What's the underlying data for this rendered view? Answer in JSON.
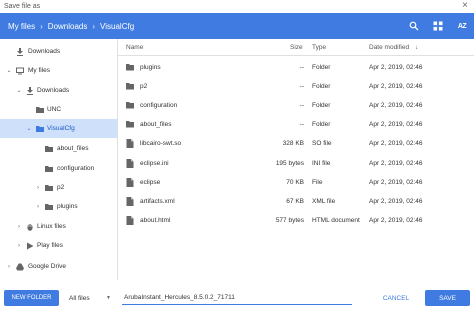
{
  "window": {
    "title": "Save file as",
    "close_glyph": "×"
  },
  "breadcrumb": {
    "items": [
      "My files",
      "Downloads",
      "VisualCfg"
    ],
    "separator": "›"
  },
  "toolbar": {
    "sort_label": "AZ",
    "icons": [
      "search-icon",
      "grid-view-icon",
      "sort-icon"
    ]
  },
  "sidebar": {
    "items": [
      {
        "label": "Downloads",
        "icon": "download-icon"
      },
      {
        "label": "My files",
        "icon": "computer-icon"
      },
      {
        "label": "Downloads",
        "icon": "download-icon"
      },
      {
        "label": "UNC",
        "icon": "folder-icon"
      },
      {
        "label": "VisualCfg",
        "icon": "folder-icon"
      },
      {
        "label": "about_files",
        "icon": "folder-icon"
      },
      {
        "label": "configuration",
        "icon": "folder-icon"
      },
      {
        "label": "p2",
        "icon": "folder-icon"
      },
      {
        "label": "plugins",
        "icon": "folder-icon"
      },
      {
        "label": "Linux files",
        "icon": "linux-icon"
      },
      {
        "label": "Play files",
        "icon": "play-icon"
      },
      {
        "label": "Google Drive",
        "icon": "drive-icon"
      }
    ]
  },
  "columns": {
    "name": "Name",
    "size": "Size",
    "type": "Type",
    "date": "Date modified",
    "sort_arrow": "↓"
  },
  "files": [
    {
      "name": "plugins",
      "size": "--",
      "type": "Folder",
      "date": "Apr 2, 2019, 02:46",
      "kind": "folder"
    },
    {
      "name": "p2",
      "size": "--",
      "type": "Folder",
      "date": "Apr 2, 2019, 02:46",
      "kind": "folder"
    },
    {
      "name": "configuration",
      "size": "--",
      "type": "Folder",
      "date": "Apr 2, 2019, 02:46",
      "kind": "folder"
    },
    {
      "name": "about_files",
      "size": "--",
      "type": "Folder",
      "date": "Apr 2, 2019, 02:46",
      "kind": "folder"
    },
    {
      "name": "libcairo-swt.so",
      "size": "328 KB",
      "type": "SO file",
      "date": "Apr 2, 2019, 02:46",
      "kind": "file"
    },
    {
      "name": "eclipse.ini",
      "size": "195 bytes",
      "type": "INI file",
      "date": "Apr 2, 2019, 02:46",
      "kind": "file"
    },
    {
      "name": "eclipse",
      "size": "70 KB",
      "type": "File",
      "date": "Apr 2, 2019, 02:46",
      "kind": "file"
    },
    {
      "name": "artifacts.xml",
      "size": "67 KB",
      "type": "XML file",
      "date": "Apr 2, 2019, 02:46",
      "kind": "file"
    },
    {
      "name": "about.html",
      "size": "577 bytes",
      "type": "HTML document",
      "date": "Apr 2, 2019, 02:46",
      "kind": "file"
    }
  ],
  "footer": {
    "new_folder": "NEW FOLDER",
    "filter": "All files",
    "filename": "ArubaInstant_Hercules_8.5.0.2_71711",
    "cancel": "CANCEL",
    "save": "SAVE"
  },
  "colors": {
    "accent": "#3f7be0",
    "selected": "#cfe0fa",
    "icon_grey": "#666666"
  }
}
